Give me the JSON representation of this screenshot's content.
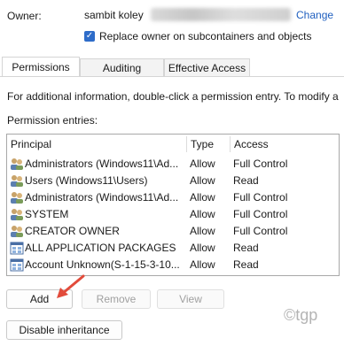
{
  "owner": {
    "label": "Owner:",
    "name": "sambit koley",
    "change_link": "Change"
  },
  "replace_owner": {
    "checked": true,
    "label": "Replace owner on subcontainers and objects"
  },
  "tabs": [
    {
      "label": "Permissions",
      "active": true
    },
    {
      "label": "Auditing",
      "active": false
    },
    {
      "label": "Effective Access",
      "active": false
    }
  ],
  "info_text": "For additional information, double-click a permission entry. To modify a",
  "entries_label": "Permission entries:",
  "table": {
    "columns": [
      "Principal",
      "Type",
      "Access"
    ],
    "rows": [
      {
        "icon": "user-group-icon",
        "principal": "Administrators (Windows11\\Ad...",
        "type": "Allow",
        "access": "Full Control"
      },
      {
        "icon": "user-group-icon",
        "principal": "Users (Windows11\\Users)",
        "type": "Allow",
        "access": "Read"
      },
      {
        "icon": "user-group-icon",
        "principal": "Administrators (Windows11\\Ad...",
        "type": "Allow",
        "access": "Full Control"
      },
      {
        "icon": "user-group-icon",
        "principal": "SYSTEM",
        "type": "Allow",
        "access": "Full Control"
      },
      {
        "icon": "user-group-icon",
        "principal": "CREATOR OWNER",
        "type": "Allow",
        "access": "Full Control"
      },
      {
        "icon": "app-package-icon",
        "principal": "ALL APPLICATION PACKAGES",
        "type": "Allow",
        "access": "Read"
      },
      {
        "icon": "app-package-icon",
        "principal": "Account Unknown(S-1-15-3-10...",
        "type": "Allow",
        "access": "Read"
      }
    ]
  },
  "buttons": {
    "add": "Add",
    "remove": "Remove",
    "view": "View",
    "disable_inheritance": "Disable inheritance"
  },
  "watermark": "©tgp",
  "colors": {
    "link": "#1f5fbf",
    "checkbox": "#2e6cc9",
    "arrow": "#e24b3b"
  }
}
